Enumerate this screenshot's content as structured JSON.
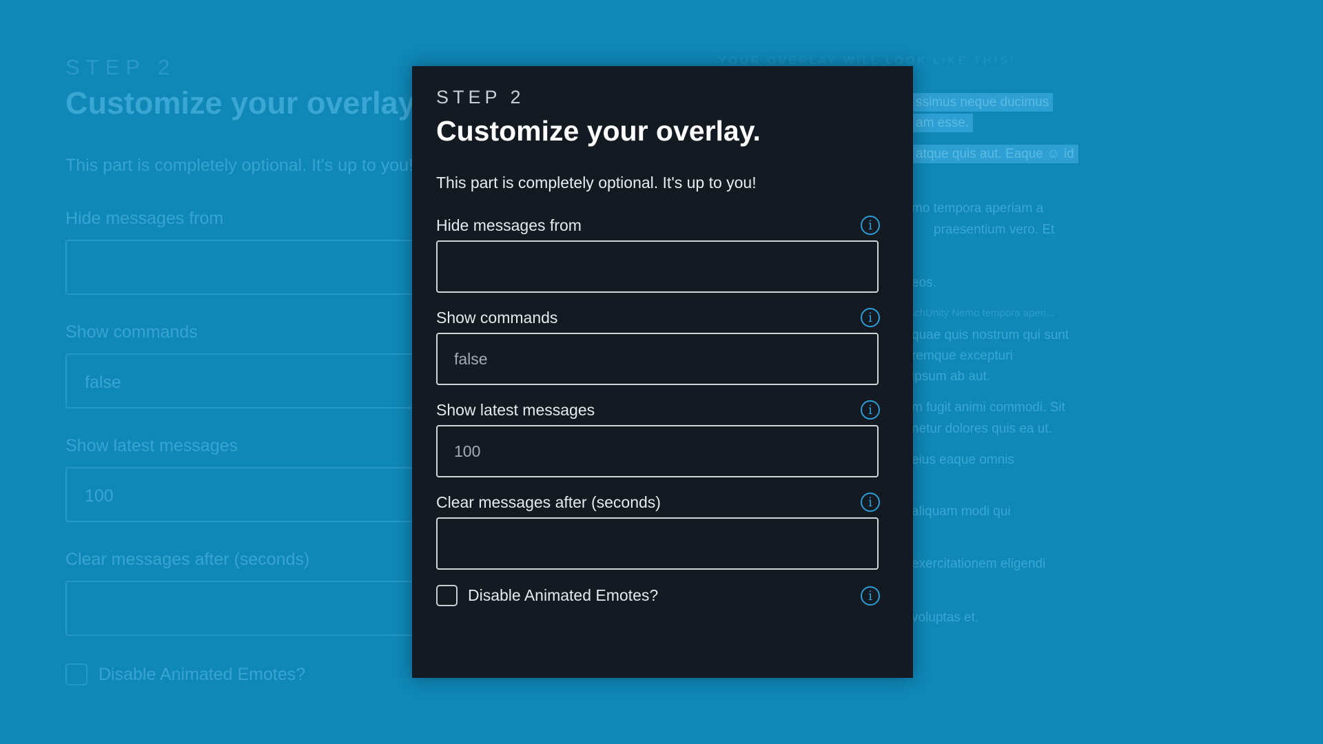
{
  "background": {
    "step": "STEP 2",
    "title": "Customize your overlay.",
    "intro": "This part is completely optional. It's up to you!",
    "fields": [
      {
        "label": "Hide messages from",
        "placeholder": ""
      },
      {
        "label": "Show commands",
        "placeholder": "false"
      },
      {
        "label": "Show latest messages",
        "placeholder": "100"
      },
      {
        "label": "Clear messages after (seconds)",
        "placeholder": ""
      }
    ],
    "checkbox_label": "Disable Animated Emotes?",
    "preview": {
      "heading": "YOUR OVERLAY WILL LOOK LIKE THIS!",
      "lines": [
        "ssimus neque ducimus",
        "am esse.",
        "atque quis aut. Eaque",
        "id",
        "mo tempora aperiam a",
        "praesentium vero. Et",
        "eos.",
        "tchUnity Nemo tempora aperi...",
        "quae quis nostrum qui sunt",
        "remque excepturi",
        "ipsum ab aut.",
        "m fugit animi commodi. Sit",
        "netur dolores quis ea ut.",
        "eius eaque omnis",
        "aliquam modi qui",
        "exercitationem eligendi",
        "voluptas et."
      ]
    }
  },
  "modal": {
    "step": "STEP 2",
    "title": "Customize your overlay.",
    "intro": "This part is completely optional. It's up to you!",
    "fields": [
      {
        "label": "Hide messages from",
        "placeholder": ""
      },
      {
        "label": "Show commands",
        "placeholder": "false"
      },
      {
        "label": "Show latest messages",
        "placeholder": "100"
      },
      {
        "label": "Clear messages after (seconds)",
        "placeholder": ""
      }
    ],
    "checkbox": {
      "label": "Disable Animated Emotes?",
      "checked": false
    },
    "info_icon": "info-circle-icon"
  },
  "colors": {
    "page_background": "#0f87b7",
    "modal_background": "#131a22",
    "info_accent": "#2c9bd6"
  }
}
